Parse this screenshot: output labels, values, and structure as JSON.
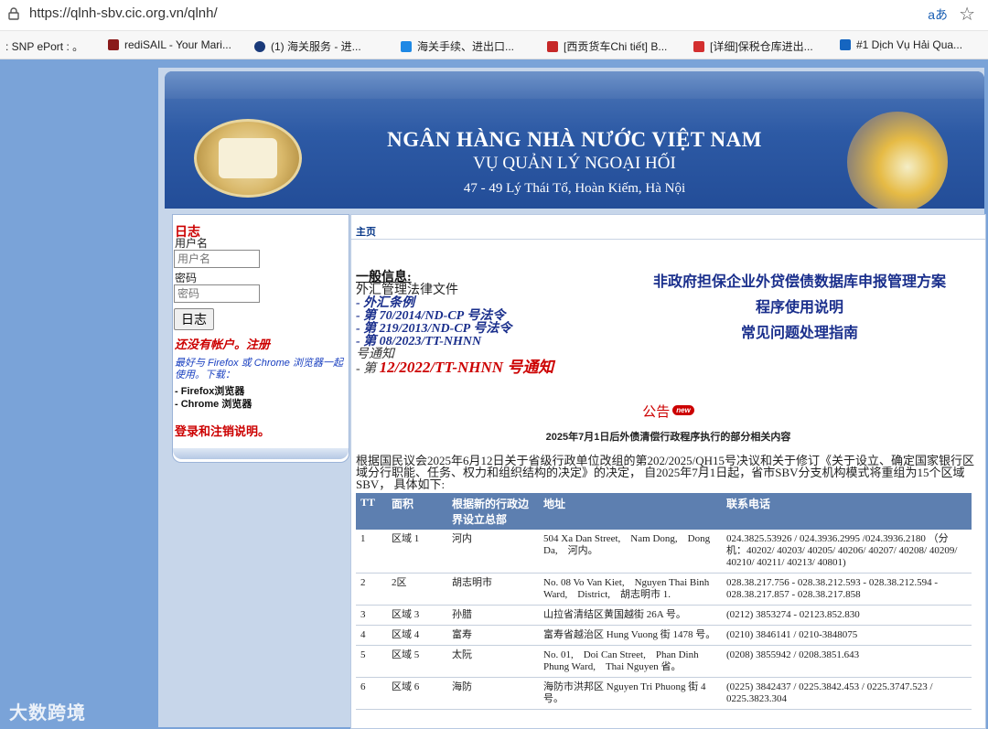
{
  "browser": {
    "url": "https://qlnh-sbv.cic.org.vn/qlnh/",
    "read_aloud": "aあ",
    "bookmarks": [
      {
        "label": ": SNP ePort : 。",
        "color": "#ffffff"
      },
      {
        "label": "rediSAIL - Your Mari...",
        "color": "#8a1a1a"
      },
      {
        "label": "(1) 海关服务 - 进...",
        "color": "#1a3a7a"
      },
      {
        "label": "海关手续、进出口...",
        "color": "#1e88e5"
      },
      {
        "label": "[西贡货车Chi tiết] B...",
        "color": "#c62828"
      },
      {
        "label": "[详细]保税仓库进出...",
        "color": "#d32f2f"
      },
      {
        "label": "#1 Dịch Vụ Hải Qua...",
        "color": "#1565c0"
      }
    ]
  },
  "banner": {
    "title": "NGÂN HÀNG NHÀ NƯỚC VIỆT NAM",
    "subtitle": "VỤ QUẢN LÝ NGOẠI HỐI",
    "address": "47 - 49 Lý Thái Tổ, Hoàn Kiếm, Hà Nội"
  },
  "sidebar": {
    "heading": "日志",
    "username_label": "用户名",
    "username_placeholder": "用户名",
    "password_label": "密码",
    "password_placeholder": "密码",
    "login_button": "日志",
    "register_text": "还没有帐户。注册",
    "hint": "最好与 Firefox 或 Chrome 浏览器一起使用。下载：",
    "download_firefox": "- Firefox浏览器",
    "download_chrome": "- Chrome 浏览器",
    "logout_text": "登录和注销说明。"
  },
  "main": {
    "breadcrumb": "主页",
    "general_info_heading": "一般信息:",
    "law_docs": "外汇管理法律文件",
    "links": [
      "- 外汇条例",
      "- 第 70/2014/ND-CP 号法令",
      "- 第 219/2013/ND-CP 号法令",
      "- 第 08/2023/TT-NHNN"
    ],
    "circular_note": "号通知",
    "circular_prefix": "- 第",
    "circular_big": "12/2022/TT-NHNN 号通知",
    "right_links": [
      "非政府担保企业外贷偿债数据库申报管理方案",
      "程序使用说明",
      "常见问题处理指南"
    ],
    "notice_label": "公告",
    "new_badge": "new",
    "notice_title": "2025年7月1日后外债清偿行政程序执行的部分相关内容",
    "intro": "根据国民议会2025年6月12日关于省级行政单位改组的第202/2025/QH15号决议和关于修订《关于设立、确定国家银行区域分行职能、任务、权力和组织结构的决定》的决定， 自2025年7月1日起，省市SBV分支机构模式将重组为15个区域SBV， 具体如下:"
  },
  "table": {
    "headers": [
      "TT",
      "面积",
      "根据新的行政边界设立总部",
      "地址",
      "联系电话"
    ],
    "rows": [
      [
        "1",
        "区域 1",
        "河内",
        "504 Xa Dan Street,　Nam Dong,　Dong Da,　河内。",
        "024.3825.53926 / 024.3936.2995 /024.3936.2180 （分机：40202/ 40203/ 40205/ 40206/ 40207/ 40208/ 40209/ 40210/ 40211/ 40213/ 40801)"
      ],
      [
        "2",
        "2区",
        "胡志明市",
        "No. 08 Vo Van Kiet,　Nguyen Thai Binh Ward,　District,　胡志明市 1.",
        "028.38.217.756 - 028.38.212.593 - 028.38.212.594 - 028.38.217.857 - 028.38.217.858"
      ],
      [
        "3",
        "区域 3",
        "孙腊",
        "山拉省清结区黄国越街 26A 号。",
        "(0212) 3853274 - 02123.852.830"
      ],
      [
        "4",
        "区域 4",
        "富寿",
        "富寿省越治区 Hung Vuong 街 1478 号。",
        "(0210) 3846141 / 0210-3848075"
      ],
      [
        "5",
        "区域 5",
        "太阮",
        "No. 01,　Doi Can Street,　Phan Dinh Phung Ward,　Thai Nguyen 省。",
        "(0208) 3855942 / 0208.3851.643"
      ],
      [
        "6",
        "区域 6",
        "海防",
        "海防市洪邦区 Nguyen Tri Phuong 街 4 号。",
        "(0225) 3842437 / 0225.3842.453 / 0225.3747.523 / 0225.3823.304"
      ]
    ]
  },
  "watermark": "大数跨境"
}
